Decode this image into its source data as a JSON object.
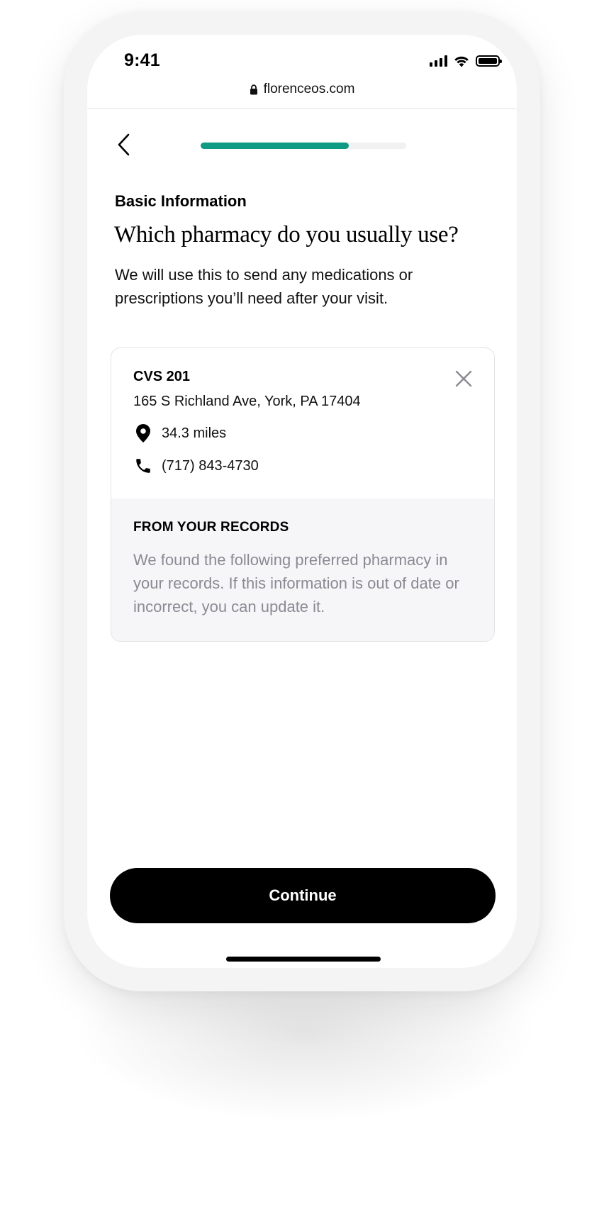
{
  "status_bar": {
    "time": "9:41"
  },
  "browser": {
    "url": "florenceos.com"
  },
  "progress": {
    "fraction": 0.72
  },
  "header": {
    "section_label": "Basic Information",
    "title": "Which pharmacy do you usually use?",
    "description": "We will use this to send any medications or prescriptions you’ll need after your visit."
  },
  "pharmacy_card": {
    "name": "CVS 201",
    "address": "165 S Richland Ave, York, PA 17404",
    "distance": "34.3 miles",
    "phone": "(717) 843-4730",
    "records_title": "FROM YOUR RECORDS",
    "records_text": "We found the following preferred pharmacy in your records. If this information is out of date or incorrect, you can update it."
  },
  "actions": {
    "continue_label": "Continue"
  },
  "colors": {
    "accent": "#0f9a83",
    "progress_track": "#f1f1f1",
    "muted_text": "#8a8a93",
    "records_bg": "#f6f6f8"
  },
  "icons": {
    "back": "chevron-left-icon",
    "close": "close-icon",
    "distance": "location-pin-icon",
    "phone": "phone-icon",
    "lock": "lock-icon"
  }
}
